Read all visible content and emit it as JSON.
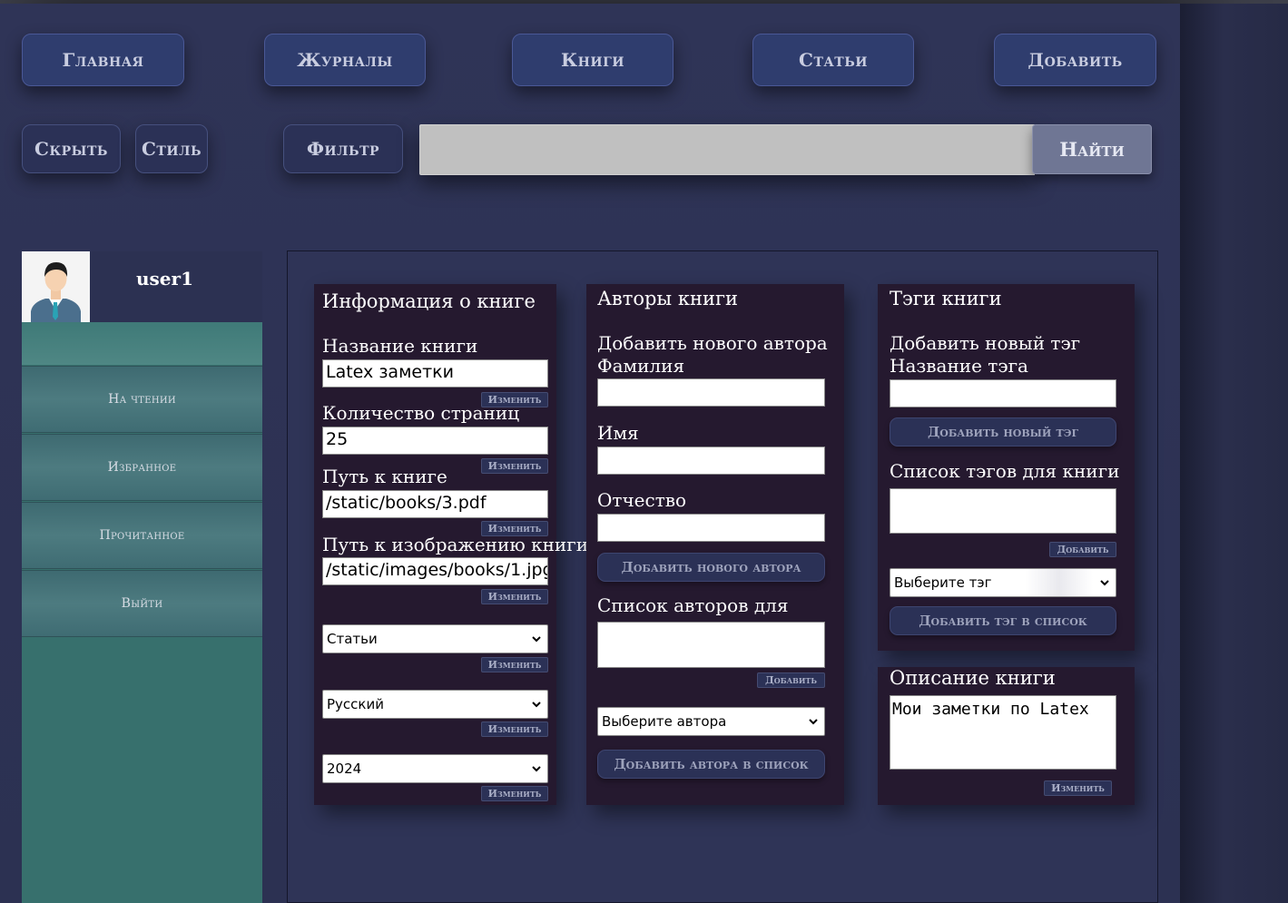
{
  "nav": {
    "home": "Главная",
    "journals": "Журналы",
    "books": "Книги",
    "articles": "Статьи",
    "add": "Добавить"
  },
  "toolbar": {
    "hide": "Скрыть",
    "style": "Стиль",
    "filter": "Фильтр",
    "search_value": "",
    "search_button": "Найти"
  },
  "sidebar": {
    "username": "user1",
    "avatar_icon": "user-avatar-icon",
    "items": [
      {
        "label": "На чтении"
      },
      {
        "label": "Избранное"
      },
      {
        "label": "Прочитанное"
      },
      {
        "label": "Выйти"
      }
    ]
  },
  "book_info": {
    "title": "Информация о книге",
    "name_label": "Название книги",
    "name_value": "Latex заметки",
    "pages_label": "Количество страниц",
    "pages_value": "25",
    "path_label": "Путь к книге",
    "path_value": "/static/books/3.pdf",
    "image_label": "Путь к изображению книги",
    "image_value": "/static/images/books/1.jpg",
    "type_value": "Статьи",
    "language_value": "Русский",
    "year_value": "2024",
    "change_label": "Изменить"
  },
  "authors": {
    "title": "Авторы книги",
    "add_new_label": "Добавить нового автора",
    "surname_label": "Фамилия",
    "name_label": "Имя",
    "patronymic_label": "Отчество",
    "add_new_button": "Добавить нового автора",
    "list_label": "Список авторов для книги",
    "add_small": "Добавить",
    "select_placeholder": "Выберите автора",
    "add_to_list_button": "Добавить автора в список"
  },
  "tags": {
    "title": "Тэги книги",
    "add_new_label": "Добавить новый тэг",
    "tag_name_label": "Название тэга",
    "add_new_button": "Добавить новый тэг",
    "list_label": "Список тэгов для книги",
    "add_small": "Добавить",
    "select_placeholder": "Выберите тэг",
    "add_to_list_button": "Добавить тэг в список"
  },
  "description": {
    "title": "Описание книги",
    "value": "Мои заметки по Latex",
    "change_label": "Изменить"
  }
}
